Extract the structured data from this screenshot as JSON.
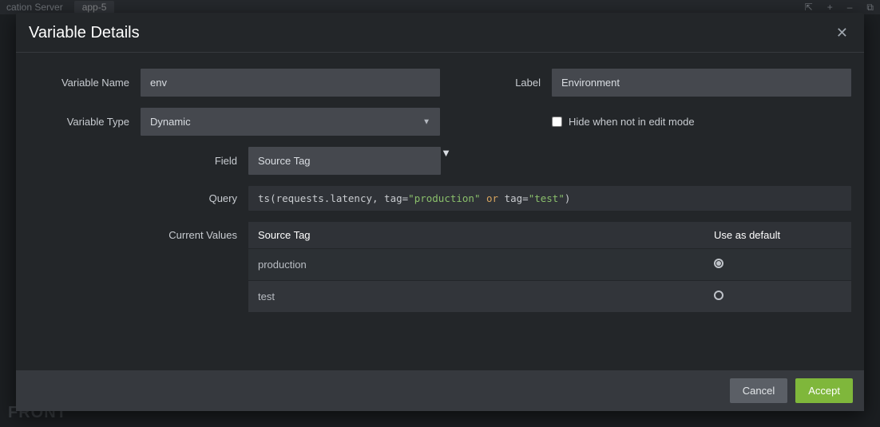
{
  "background": {
    "header_left": "cation Server",
    "header_tab": "app-5",
    "brand": "FRONT"
  },
  "modal": {
    "title": "Variable Details"
  },
  "form": {
    "variable_name_label": "Variable Name",
    "variable_name_value": "env",
    "label_label": "Label",
    "label_value": "Environment",
    "variable_type_label": "Variable Type",
    "variable_type_value": "Dynamic",
    "hide_checkbox_label": "Hide when not in edit mode",
    "field_label": "Field",
    "field_value": "Source Tag",
    "query_label": "Query",
    "query_fn": "ts",
    "query_paren_open": "(",
    "query_metric": "requests.latency, tag=",
    "query_str1": "\"production\"",
    "query_kw": " or ",
    "query_tag2": "tag=",
    "query_str2": "\"test\"",
    "query_paren_close": ")",
    "current_values_label": "Current Values"
  },
  "table": {
    "header_tag": "Source Tag",
    "header_default": "Use as default",
    "rows": [
      {
        "tag": "production",
        "default": true
      },
      {
        "tag": "test",
        "default": false
      }
    ]
  },
  "buttons": {
    "cancel": "Cancel",
    "accept": "Accept"
  }
}
